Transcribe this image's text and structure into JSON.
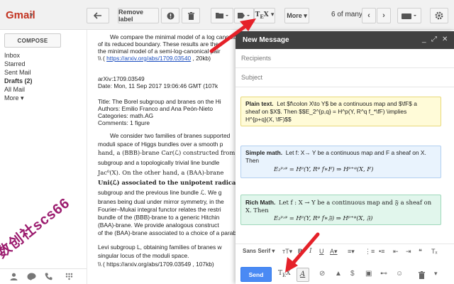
{
  "app": {
    "name": "Gmail"
  },
  "toolbar": {
    "remove_label": "Remove label",
    "more": "More",
    "pager": "6 of many"
  },
  "compose_button": "COMPOSE",
  "nav": [
    {
      "label": "Inbox"
    },
    {
      "label": "Starred"
    },
    {
      "label": "Sent Mail"
    },
    {
      "label": "Drafts (2)"
    },
    {
      "label": "All Mail"
    },
    {
      "label": "More ▾"
    }
  ],
  "watermark": "数创社scs66",
  "email": {
    "p1": [
      "We compare the minimal model of a log canonical pair",
      "of its reduced boundary. These results are then",
      "the minimal model of a semi-log-canonical pair",
      "\\\\ ( https://arxiv.org/abs/1709.03540 , 20kb)"
    ],
    "p1_link": "https://arxiv.org/abs/1709.03540",
    "meta": [
      "arXiv:1709.03549",
      "Date: Mon, 11 Sep 2017 19:06:46 GMT  (107k",
      "",
      "Title: The Borel subgroup and branes on the Hi",
      "Authors: Emilio Franco and Ana Peón-Nieto",
      "Categories: math.AG",
      "Comments: 1 figure"
    ],
    "p2": [
      "We consider two families of branes supported",
      "moduli space of Higgs bundles over a smooth p",
      "hand, a (BBB)-brane Car(ℒ) constructed from",
      "subgroup and a topologically trivial line bundle",
      "Jac⁰(X). On the other hand, a (BAA)-brane",
      "Uni(ℒ) associated to the unipotent radical of t",
      "subgroup and the previous line bundle ℒ. We g",
      "branes being dual under mirror symmetry, in the",
      "Fourier–Mukai integral functor relates the restri",
      "bundle of the (BBB)-brane to a generic Hitchin",
      "(BAA)-brane. We provide analogous construct",
      "of the (BAA)-brane associated to a choice of a parab",
      "Levi subgroup L, obtaining families of branes w",
      "singular locus of the moduli space.",
      "\\\\ ( https://arxiv.org/abs/1709.03549 , 107kb)"
    ]
  },
  "compose": {
    "title": "New Message",
    "recipients": "Recipients",
    "subject": "Subject",
    "plain_label": "Plain text.",
    "plain_lines": [
      "Let $f\\colon X\\to Y$ be a continuous map and $\\fF$ a",
      "sheaf on $X$. Then $$E_2^{p,q} = H^p(Y, R^q f_*\\fF) \\implies",
      "H^{p+q}(X, \\fF)$$"
    ],
    "simple_label": "Simple math.",
    "simple_lines": [
      "Let f: X→ Y be a continuous map and F a sheaf on X.",
      "Then"
    ],
    "simple_eq": "E₂ᵖ˒ᵠ = Hᵖ(Y, Rᵠ f∗F) ⇒ Hᵖ⁺ᵠ(X, F)",
    "rich_label": "Rich Math.",
    "rich_lines": [
      "Let f : X → Y be a continuous map and 𝔉 a sheaf on",
      "X. Then"
    ],
    "rich_eq": "E₂ᵖ˒ᵠ = Hᵖ(Y, Rᵠ f∗𝔉) ⇒ Hᵖ⁺ᵠ(X, 𝔉)",
    "font": "Sans Serif",
    "send": "Send"
  },
  "colors": {
    "accent_red": "#e52129",
    "send_blue": "#4a8af4",
    "plain_bg": "#fffbd8",
    "simple_bg": "#e9f3fd",
    "rich_bg": "#e1f6ec"
  }
}
